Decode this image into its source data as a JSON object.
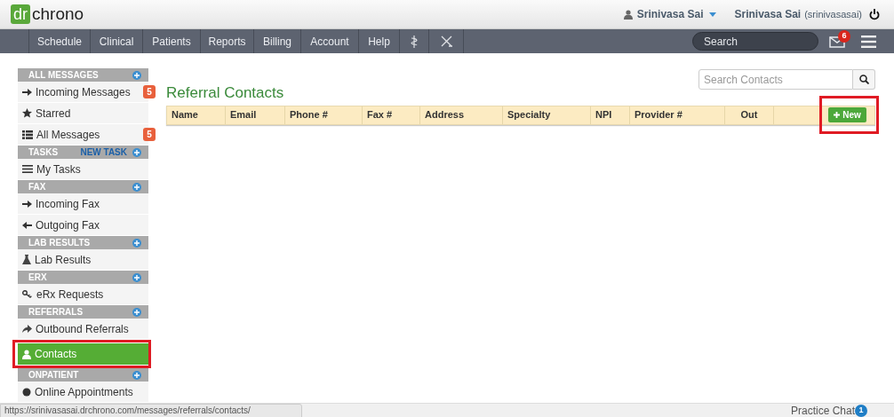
{
  "header": {
    "logo_mark": "dr",
    "logo_text": "chrono",
    "user_menu": "Srinivasa Sai",
    "account_name": "Srinivasa Sai",
    "account_username": "(srinivasasai)"
  },
  "nav": {
    "items": [
      "Schedule",
      "Clinical",
      "Patients",
      "Reports",
      "Billing",
      "Account",
      "Help"
    ],
    "search_placeholder": "Search",
    "mail_badge": "6"
  },
  "sidebar": {
    "sections": [
      {
        "title": "ALL MESSAGES",
        "items": [
          {
            "label": "Incoming Messages",
            "badge": "5",
            "selected": false,
            "highlighted": false
          },
          {
            "label": "Starred",
            "selected": false,
            "highlighted": false
          },
          {
            "label": "All Messages",
            "badge": "5",
            "selected": false,
            "highlighted": false
          }
        ]
      },
      {
        "title": "TASKS",
        "action": "NEW TASK",
        "items": [
          {
            "label": "My Tasks",
            "selected": false,
            "highlighted": false
          }
        ]
      },
      {
        "title": "FAX",
        "items": [
          {
            "label": "Incoming Fax",
            "selected": false,
            "highlighted": false
          },
          {
            "label": "Outgoing Fax",
            "selected": false,
            "highlighted": false
          }
        ]
      },
      {
        "title": "LAB RESULTS",
        "items": [
          {
            "label": "Lab Results",
            "selected": false,
            "highlighted": false
          }
        ]
      },
      {
        "title": "ERX",
        "items": [
          {
            "label": "eRx Requests",
            "selected": false,
            "highlighted": false
          }
        ]
      },
      {
        "title": "REFERRALS",
        "items": [
          {
            "label": "Outbound Referrals",
            "selected": false,
            "highlighted": false
          },
          {
            "label": "Contacts",
            "selected": true,
            "highlighted": true
          }
        ]
      },
      {
        "title": "ONPATIENT",
        "items": [
          {
            "label": "Online Appointments",
            "selected": false,
            "highlighted": false
          }
        ]
      }
    ]
  },
  "main": {
    "title": "Referral Contacts",
    "search_placeholder": "Search Contacts",
    "table": {
      "columns": [
        "Name",
        "Email",
        "Phone #",
        "Fax #",
        "Address",
        "Specialty",
        "NPI",
        "Provider #",
        "Out"
      ]
    },
    "new_button": {
      "label": "New",
      "highlighted": true
    }
  },
  "status_bar": {
    "url": "https://srinivasasai.drchrono.com/messages/referrals/contacts/",
    "chat_label": "Practice Chat",
    "chat_badge": "1"
  }
}
